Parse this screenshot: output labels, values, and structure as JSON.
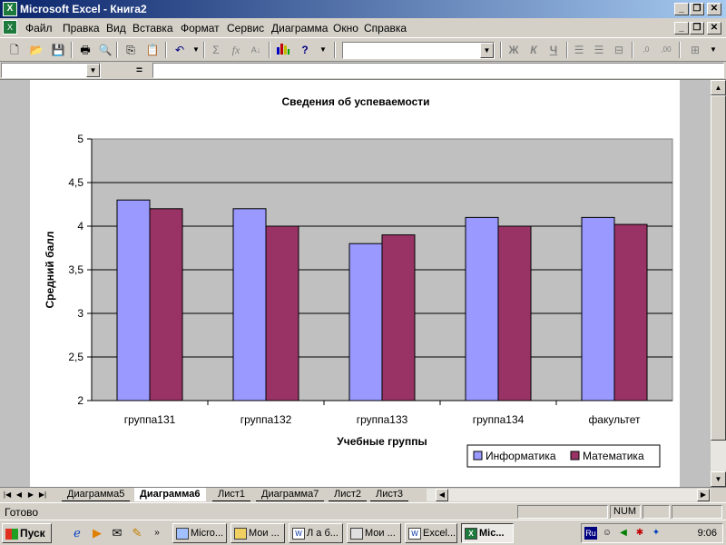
{
  "window": {
    "title": "Microsoft Excel - Книга2",
    "app_icon": "excel-icon",
    "btn_minimize": "_",
    "btn_restore": "❐",
    "btn_close": "✕"
  },
  "menu": {
    "items": [
      "Файл",
      "Правка",
      "Вид",
      "Вставка",
      "Формат",
      "Сервис",
      "Диаграмма",
      "Окно",
      "Справка"
    ]
  },
  "toolbar": {
    "icons": [
      "new-icon",
      "open-icon",
      "save-icon",
      "print-icon",
      "print-preview-icon",
      "copy-icon",
      "paste-icon",
      "undo-icon",
      "autosum-icon",
      "function-icon",
      "sort-icon",
      "chart-wizard-icon",
      "help-icon",
      "bold-icon",
      "italic-icon",
      "underline-icon",
      "align-left-icon",
      "align-center-icon",
      "merge-icon",
      "increase-decimal-icon",
      "decrease-decimal-icon",
      "borders-icon"
    ],
    "bold_glyph": "Ж",
    "italic_glyph": "К",
    "underline_glyph": "Ч",
    "font_name": ""
  },
  "formula_bar": {
    "name_box": "",
    "equals": "=",
    "formula": ""
  },
  "chart_data": {
    "type": "bar",
    "title": "Сведения об успеваемости",
    "xlabel": "Учебные группы",
    "ylabel": "Средний балл",
    "categories": [
      "группа131",
      "группа132",
      "группа133",
      "группа134",
      "факультет"
    ],
    "series": [
      {
        "name": "Информатика",
        "color": "#9999ff",
        "values": [
          4.3,
          4.2,
          3.8,
          4.1,
          4.1
        ]
      },
      {
        "name": "Математика",
        "color": "#993366",
        "values": [
          4.2,
          4.0,
          3.9,
          4.0,
          4.02
        ]
      }
    ],
    "ylim": [
      2,
      5
    ],
    "yticks": [
      "2",
      "2,5",
      "3",
      "3,5",
      "4",
      "4,5",
      "5"
    ],
    "plot_background": "#c0c0c0",
    "grid": true,
    "legend_position": "bottom-right"
  },
  "sheet_tabs": {
    "tabs": [
      "Диаграмма5",
      "Диаграмма6",
      "Лист1",
      "Диаграмма7",
      "Лист2",
      "Лист3"
    ],
    "active": "Диаграмма6"
  },
  "status_bar": {
    "text": "Готово",
    "num": "NUM"
  },
  "taskbar": {
    "start_label": "Пуск",
    "buttons": [
      "Micro...",
      "Мои ...",
      "Л а б...",
      "Мои ...",
      "Excel...",
      "Mic..."
    ],
    "active_index": 5,
    "tray_lang": "Ru",
    "clock": "9:06"
  }
}
